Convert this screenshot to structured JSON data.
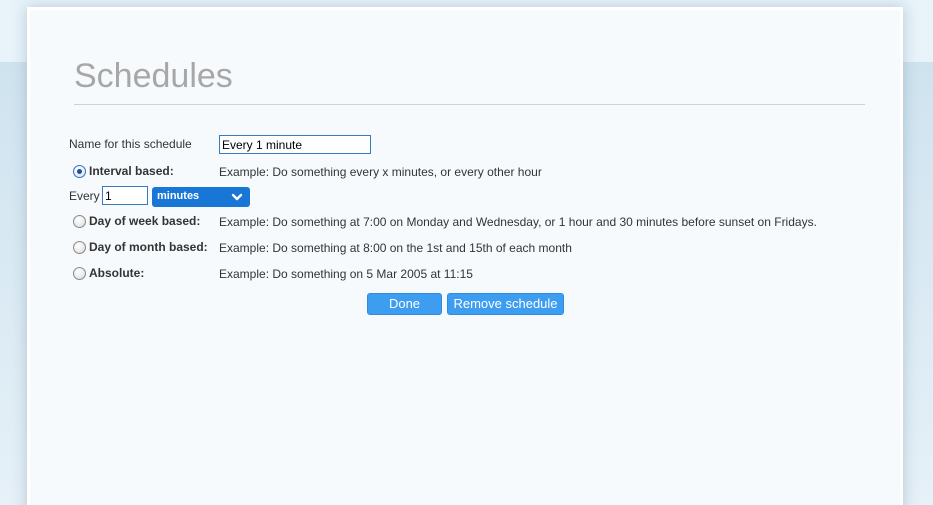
{
  "page": {
    "title": "Schedules"
  },
  "form": {
    "name_label": "Name for this schedule",
    "name_value": "Every 1 minute",
    "options": [
      {
        "label": "Interval based:",
        "example": "Example: Do something every x minutes, or every other hour",
        "checked": true
      },
      {
        "label": "Day of week based:",
        "example": "Example: Do something at 7:00 on Monday and Wednesday, or 1 hour and 30 minutes before sunset on Fridays.",
        "checked": false
      },
      {
        "label": "Day of month based:",
        "example": "Example: Do something at 8:00 on the 1st and 15th of each month",
        "checked": false
      },
      {
        "label": "Absolute:",
        "example": "Example: Do something on 5 Mar 2005 at 11:15",
        "checked": false
      }
    ],
    "interval": {
      "every_label": "Every",
      "value": "1",
      "unit": "minutes"
    }
  },
  "buttons": {
    "done": "Done",
    "remove": "Remove schedule"
  },
  "colors": {
    "accent": "#3d9df0",
    "select_bg": "#1877d6",
    "title": "#a7a7a7",
    "background": "#e8f3fa"
  }
}
